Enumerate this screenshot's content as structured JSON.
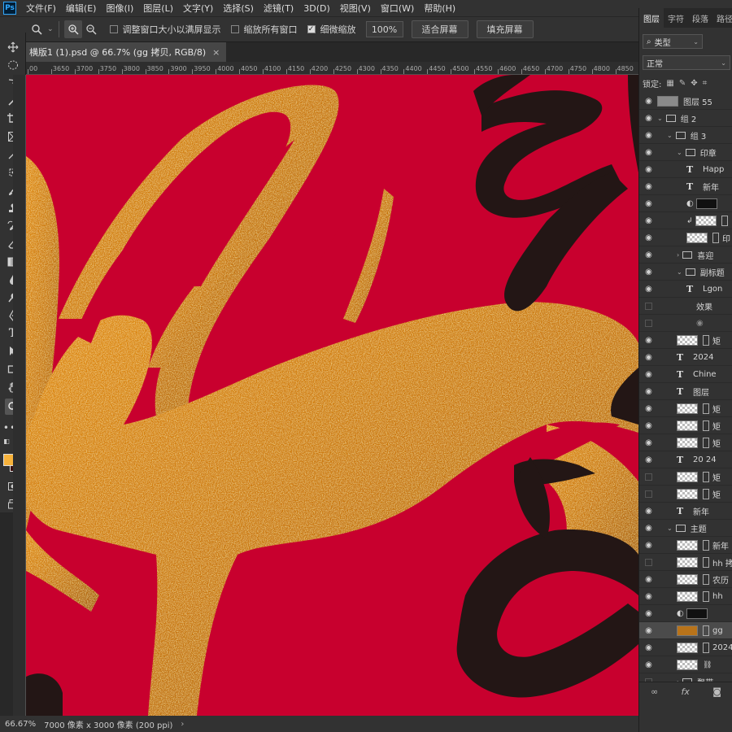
{
  "menu": {
    "logo": "Ps",
    "items": [
      "文件(F)",
      "编辑(E)",
      "图像(I)",
      "图层(L)",
      "文字(Y)",
      "选择(S)",
      "滤镜(T)",
      "3D(D)",
      "视图(V)",
      "窗口(W)",
      "帮助(H)"
    ]
  },
  "options": {
    "resize_windows": "调整窗口大小以满屏显示",
    "zoom_all": "缩放所有窗口",
    "scrubby_zoom": "细微缩放",
    "zoom_value": "100%",
    "fit_screen": "适合屏幕",
    "fill_screen": "填充屏幕"
  },
  "document": {
    "tab_title": "横版1 (1).psd @ 66.7% (gg 拷贝, RGB/8)",
    "close": "×"
  },
  "ruler": {
    "ticks": [
      "00",
      "3650",
      "3700",
      "3750",
      "3800",
      "3850",
      "3900",
      "3950",
      "4000",
      "4050",
      "4100",
      "4150",
      "4200",
      "4250",
      "4300",
      "4350",
      "4400",
      "4450",
      "4500",
      "4550",
      "4600",
      "4650",
      "4700",
      "4750",
      "4800",
      "4850"
    ]
  },
  "status": {
    "zoom": "66.67%",
    "doc_size": "7000 像素 x 3000 像素 (200 ppi)",
    "arrow": "›"
  },
  "colors": {
    "foreground": "#f7b23b",
    "background": "#3a1010",
    "canvas_red": "#c8002e"
  },
  "panel": {
    "tabs": [
      "图层",
      "字符",
      "段落",
      "路径"
    ],
    "filter_kind": "类型",
    "blend_mode": "正常",
    "lock_label": "锁定:",
    "layers": [
      {
        "name": "图层 55",
        "indent": 0,
        "kind": "gray",
        "visible": true
      },
      {
        "name": "组 2",
        "indent": 0,
        "kind": "folder",
        "visible": true
      },
      {
        "name": "组 3",
        "indent": 1,
        "kind": "folder",
        "visible": true
      },
      {
        "name": "印章",
        "indent": 2,
        "kind": "folder",
        "visible": true
      },
      {
        "name": "Happ",
        "indent": 3,
        "kind": "text",
        "visible": true
      },
      {
        "name": "新年",
        "indent": 3,
        "kind": "text",
        "visible": true
      },
      {
        "name": "",
        "indent": 3,
        "kind": "adjust",
        "visible": true
      },
      {
        "name": "",
        "indent": 3,
        "kind": "clip",
        "visible": true
      },
      {
        "name": "印",
        "indent": 3,
        "kind": "smart",
        "visible": true
      },
      {
        "name": "喜迎",
        "indent": 2,
        "kind": "folder",
        "visible": true
      },
      {
        "name": "副标题",
        "indent": 2,
        "kind": "folder",
        "visible": true
      },
      {
        "name": "Lgon",
        "indent": 3,
        "kind": "text",
        "visible": true
      },
      {
        "name": "效果",
        "indent": 4,
        "kind": "fx",
        "visible": false
      },
      {
        "name": "",
        "indent": 4,
        "kind": "eyefx",
        "visible": false
      },
      {
        "name": "矩",
        "indent": 2,
        "kind": "smart",
        "visible": true
      },
      {
        "name": "2024",
        "indent": 2,
        "kind": "text",
        "visible": true
      },
      {
        "name": "Chine",
        "indent": 2,
        "kind": "text",
        "visible": true
      },
      {
        "name": "图层",
        "indent": 2,
        "kind": "text",
        "visible": true
      },
      {
        "name": "矩",
        "indent": 2,
        "kind": "smart",
        "visible": true
      },
      {
        "name": "矩",
        "indent": 2,
        "kind": "smart",
        "visible": true
      },
      {
        "name": "矩",
        "indent": 2,
        "kind": "smart",
        "visible": true
      },
      {
        "name": "20 24",
        "indent": 2,
        "kind": "text",
        "visible": true
      },
      {
        "name": "矩",
        "indent": 2,
        "kind": "smart",
        "visible": false
      },
      {
        "name": "矩",
        "indent": 2,
        "kind": "smart",
        "visible": false
      },
      {
        "name": "新年",
        "indent": 2,
        "kind": "text",
        "visible": true
      },
      {
        "name": "主题",
        "indent": 1,
        "kind": "folder",
        "visible": true
      },
      {
        "name": "新年",
        "indent": 2,
        "kind": "smart",
        "visible": true
      },
      {
        "name": "hh 拷",
        "indent": 2,
        "kind": "smart",
        "visible": false
      },
      {
        "name": "农历",
        "indent": 2,
        "kind": "smart",
        "visible": true
      },
      {
        "name": "hh",
        "indent": 2,
        "kind": "smart",
        "visible": true
      },
      {
        "name": "",
        "indent": 2,
        "kind": "adjust2",
        "visible": true
      },
      {
        "name": "gg",
        "indent": 2,
        "kind": "gold",
        "visible": true,
        "selected": true
      },
      {
        "name": "2024",
        "indent": 2,
        "kind": "smart",
        "visible": true
      },
      {
        "name": "",
        "indent": 2,
        "kind": "link",
        "visible": true
      },
      {
        "name": "飘带",
        "indent": 2,
        "kind": "folder",
        "visible": false
      }
    ]
  }
}
